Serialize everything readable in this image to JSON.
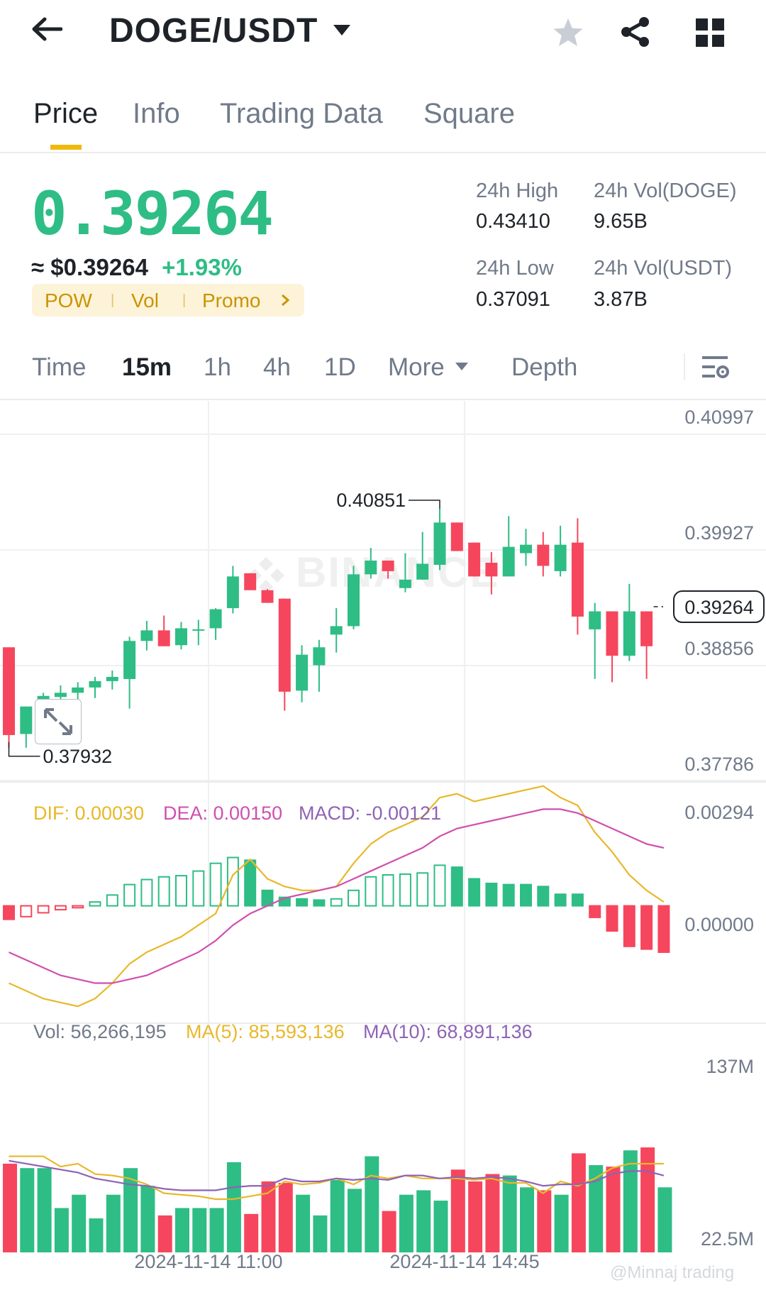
{
  "header": {
    "pair": "DOGE/USDT"
  },
  "tabs": [
    {
      "label": "Price"
    },
    {
      "label": "Info"
    },
    {
      "label": "Trading Data"
    },
    {
      "label": "Square"
    }
  ],
  "ticker": {
    "last_price": "0.39264",
    "usd_price": "≈ $0.39264",
    "change_pct": "+1.93%",
    "tags": [
      "POW",
      "Vol",
      "Promo"
    ],
    "high_label": "24h High",
    "high_value": "0.43410",
    "low_label": "24h Low",
    "low_value": "0.37091",
    "vol_base_label": "24h Vol(DOGE)",
    "vol_base_value": "9.65B",
    "vol_quote_label": "24h Vol(USDT)",
    "vol_quote_value": "3.87B"
  },
  "intervals": [
    {
      "label": "Time",
      "active": false
    },
    {
      "label": "15m",
      "active": true
    },
    {
      "label": "1h",
      "active": false
    },
    {
      "label": "4h",
      "active": false
    },
    {
      "label": "1D",
      "active": false
    },
    {
      "label": "More",
      "active": false
    },
    {
      "label": "Depth",
      "active": false
    }
  ],
  "watermark": "BINANCE",
  "credit": "@Minnaj trading",
  "colors": {
    "up": "#2ebd85",
    "down": "#f6465d",
    "accent": "#f0b90b",
    "dif": "#e8b82a",
    "dea": "#d04fae",
    "macd": "#8e63b5"
  },
  "chart_data": [
    {
      "type": "candlestick",
      "interval": "15m",
      "y_ticks": [
        "0.40997",
        "0.39927",
        "0.38856",
        "0.37786"
      ],
      "ylim": [
        0.3762,
        0.4121
      ],
      "current_price": "0.39264",
      "high_annotation": "0.40851",
      "low_annotation": "0.37932",
      "x_labels": [
        "2024-11-14 11:00",
        "2024-11-14 14:45"
      ],
      "candles": [
        {
          "o": 0.3888,
          "h": 0.3888,
          "l": 0.3793,
          "c": 0.3805
        },
        {
          "o": 0.3806,
          "h": 0.383,
          "l": 0.3793,
          "c": 0.3832
        },
        {
          "o": 0.3832,
          "h": 0.3845,
          "l": 0.382,
          "c": 0.3842
        },
        {
          "o": 0.3841,
          "h": 0.3852,
          "l": 0.383,
          "c": 0.3845
        },
        {
          "o": 0.3845,
          "h": 0.3855,
          "l": 0.3835,
          "c": 0.385
        },
        {
          "o": 0.385,
          "h": 0.386,
          "l": 0.384,
          "c": 0.3856
        },
        {
          "o": 0.3856,
          "h": 0.3866,
          "l": 0.3848,
          "c": 0.386
        },
        {
          "o": 0.3858,
          "h": 0.3898,
          "l": 0.383,
          "c": 0.3894
        },
        {
          "o": 0.3894,
          "h": 0.3913,
          "l": 0.3885,
          "c": 0.3904
        },
        {
          "o": 0.3904,
          "h": 0.3918,
          "l": 0.389,
          "c": 0.3889
        },
        {
          "o": 0.389,
          "h": 0.3912,
          "l": 0.3886,
          "c": 0.3906
        },
        {
          "o": 0.3904,
          "h": 0.3914,
          "l": 0.389,
          "c": 0.3905
        },
        {
          "o": 0.3906,
          "h": 0.3925,
          "l": 0.3895,
          "c": 0.3924
        },
        {
          "o": 0.3925,
          "h": 0.3965,
          "l": 0.392,
          "c": 0.3955
        },
        {
          "o": 0.3958,
          "h": 0.3952,
          "l": 0.3944,
          "c": 0.3942
        },
        {
          "o": 0.3942,
          "h": 0.3943,
          "l": 0.394,
          "c": 0.393
        },
        {
          "o": 0.3934,
          "h": 0.3932,
          "l": 0.3828,
          "c": 0.3846
        },
        {
          "o": 0.3847,
          "h": 0.389,
          "l": 0.3836,
          "c": 0.3881
        },
        {
          "o": 0.3871,
          "h": 0.3895,
          "l": 0.3846,
          "c": 0.3888
        },
        {
          "o": 0.39,
          "h": 0.3925,
          "l": 0.3883,
          "c": 0.3908
        },
        {
          "o": 0.3908,
          "h": 0.3965,
          "l": 0.3905,
          "c": 0.3957
        },
        {
          "o": 0.3957,
          "h": 0.3982,
          "l": 0.3953,
          "c": 0.397
        },
        {
          "o": 0.397,
          "h": 0.3955,
          "l": 0.3953,
          "c": 0.396
        },
        {
          "o": 0.3944,
          "h": 0.3977,
          "l": 0.394,
          "c": 0.3952
        },
        {
          "o": 0.3952,
          "h": 0.3997,
          "l": 0.3953,
          "c": 0.3967
        },
        {
          "o": 0.3966,
          "h": 0.4019,
          "l": 0.3961,
          "c": 0.4006
        },
        {
          "o": 0.4006,
          "h": 0.4001,
          "l": 0.3983,
          "c": 0.3979
        },
        {
          "o": 0.3987,
          "h": 0.3975,
          "l": 0.3955,
          "c": 0.3955
        },
        {
          "o": 0.3968,
          "h": 0.3978,
          "l": 0.3938,
          "c": 0.3955
        },
        {
          "o": 0.3955,
          "h": 0.4012,
          "l": 0.3955,
          "c": 0.3983
        },
        {
          "o": 0.3977,
          "h": 0.4,
          "l": 0.3965,
          "c": 0.3985
        },
        {
          "o": 0.3985,
          "h": 0.3997,
          "l": 0.3955,
          "c": 0.3965
        },
        {
          "o": 0.396,
          "h": 0.4003,
          "l": 0.3955,
          "c": 0.3985
        },
        {
          "o": 0.3987,
          "h": 0.401,
          "l": 0.39,
          "c": 0.3917
        },
        {
          "o": 0.3905,
          "h": 0.393,
          "l": 0.3858,
          "c": 0.3922
        },
        {
          "o": 0.3922,
          "h": 0.3922,
          "l": 0.3855,
          "c": 0.388
        },
        {
          "o": 0.388,
          "h": 0.3948,
          "l": 0.3875,
          "c": 0.3922
        },
        {
          "o": 0.3922,
          "h": 0.3922,
          "l": 0.3858,
          "c": 0.3889
        }
      ]
    },
    {
      "type": "macd",
      "labels": {
        "dif": "DIF: 0.00030",
        "dea": "DEA: 0.00150",
        "macd": "MACD: -0.00121"
      },
      "y_ticks": [
        "0.00294",
        "0.00000"
      ],
      "ylim": [
        -0.003,
        0.00315
      ],
      "histogram": [
        -0.00035,
        -0.00028,
        -0.00018,
        -0.0001,
        -5e-05,
        0.0001,
        0.00028,
        0.00055,
        0.00068,
        0.00075,
        0.00078,
        0.0009,
        0.0011,
        0.00125,
        0.00118,
        0.0004,
        0.00022,
        0.00018,
        0.00015,
        0.00018,
        0.0004,
        0.00075,
        0.0008,
        0.00082,
        0.00085,
        0.00105,
        0.001,
        0.0007,
        0.00058,
        0.00055,
        0.00055,
        0.0005,
        0.0003,
        0.0003,
        -0.0003,
        -0.00065,
        -0.00105,
        -0.00112,
        -0.0012
      ],
      "dif": [
        -0.002,
        -0.0022,
        -0.0024,
        -0.0025,
        -0.0026,
        -0.0024,
        -0.002,
        -0.0015,
        -0.0012,
        -0.001,
        -0.0008,
        -0.0005,
        -0.0002,
        0.0008,
        0.0012,
        0.0007,
        0.0005,
        0.0004,
        0.0004,
        0.0005,
        0.0011,
        0.0016,
        0.0019,
        0.0021,
        0.0023,
        0.0028,
        0.0029,
        0.0027,
        0.0028,
        0.0029,
        0.003,
        0.0031,
        0.0028,
        0.0026,
        0.0019,
        0.0014,
        0.0008,
        0.0004,
        0.0001
      ],
      "dea": [
        -0.0012,
        -0.0014,
        -0.0016,
        -0.0018,
        -0.0019,
        -0.002,
        -0.002,
        -0.0019,
        -0.0018,
        -0.0016,
        -0.0014,
        -0.0012,
        -0.0009,
        -0.0005,
        -0.0002,
        0.0,
        0.0002,
        0.0003,
        0.0004,
        0.0005,
        0.0007,
        0.0009,
        0.0011,
        0.0013,
        0.0015,
        0.0018,
        0.002,
        0.0021,
        0.0022,
        0.0023,
        0.0024,
        0.0025,
        0.0025,
        0.0024,
        0.0022,
        0.002,
        0.0018,
        0.0016,
        0.0015
      ]
    },
    {
      "type": "volume",
      "labels": {
        "vol": "Vol: 56,266,195",
        "ma5": "MA(5): 85,593,136",
        "ma10": "MA(10): 68,891,136"
      },
      "y_ticks": [
        "137M",
        "22.5M"
      ],
      "ylim": [
        0,
        155
      ],
      "volumes": [
        60,
        57,
        57,
        30,
        39,
        23,
        39,
        57,
        45,
        25,
        30,
        30,
        30,
        61,
        26,
        48,
        47,
        39,
        25,
        49,
        43,
        65,
        28,
        39,
        42,
        35,
        56,
        48,
        53,
        52,
        44,
        42,
        39,
        67,
        59,
        58,
        69,
        71,
        44
      ],
      "ma5": [
        65,
        65,
        65,
        58,
        60,
        53,
        52,
        50,
        46,
        40,
        39,
        38,
        36,
        36,
        38,
        40,
        48,
        46,
        47,
        50,
        46,
        52,
        50,
        52,
        50,
        50,
        50,
        49,
        50,
        47,
        47,
        40,
        48,
        45,
        50,
        57,
        60,
        60,
        60
      ],
      "ma10": [
        62,
        60,
        58,
        56,
        54,
        50,
        48,
        46,
        45,
        43,
        42,
        42,
        42,
        44,
        45,
        45,
        50,
        48,
        48,
        50,
        49,
        50,
        49,
        52,
        52,
        50,
        51,
        50,
        51,
        50,
        48,
        45,
        46,
        46,
        48,
        53,
        55,
        55,
        52
      ]
    }
  ]
}
